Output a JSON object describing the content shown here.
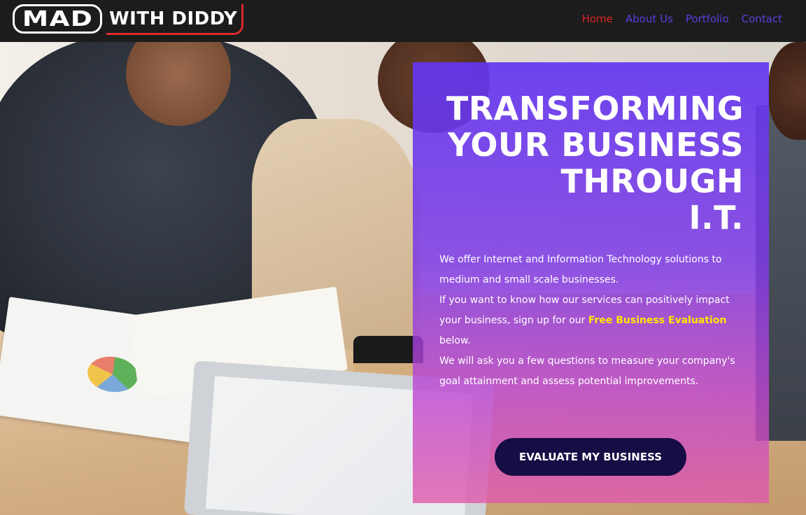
{
  "brand": {
    "logo_mark": "MAD",
    "logo_text": "WITH DIDDY"
  },
  "nav": {
    "items": [
      {
        "label": "Home",
        "active": true
      },
      {
        "label": "About Us",
        "active": false
      },
      {
        "label": "Portfolio",
        "active": false
      },
      {
        "label": "Contact",
        "active": false
      }
    ]
  },
  "hero": {
    "headline": [
      "TRANSFORMING",
      "YOUR BUSINESS",
      "THROUGH",
      "I.T."
    ],
    "paragraph1": "We offer Internet and Information Technology solutions to medium and small scale businesses.",
    "paragraph2_before": "If you want to know how our services can positively impact your business, sign up for our ",
    "paragraph2_highlight": "Free Business Evaluation",
    "paragraph2_after": " below.",
    "paragraph3": "We will ask you a few questions to measure your company's goal attainment and assess potential improvements.",
    "cta_label": "EVALUATE MY BUSINESS"
  },
  "colors": {
    "nav_bg": "#1c1c1c",
    "nav_link": "#5a3ee0",
    "nav_active": "#e02424",
    "highlight": "#ffe600",
    "cta_bg": "#160d45",
    "card_top": "#6236f0",
    "card_bottom": "#e15aaa"
  }
}
